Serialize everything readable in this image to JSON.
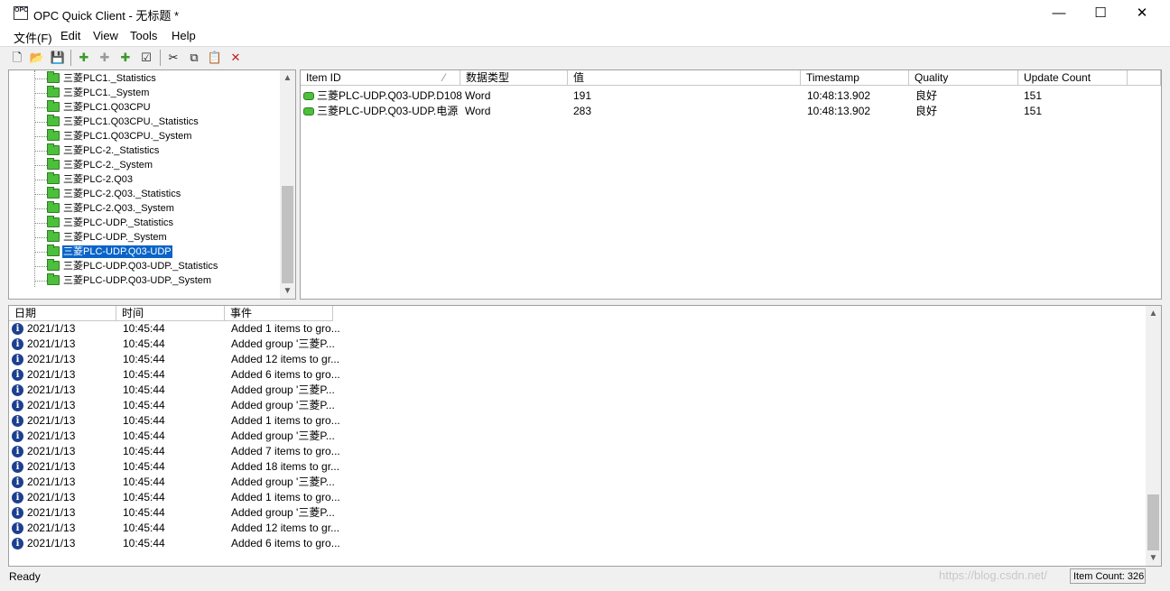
{
  "window": {
    "title": "OPC Quick Client - 无标题 *",
    "app_icon_text": "OPC",
    "controls": {
      "minimize": "—",
      "maximize": "☐",
      "close": "✕"
    }
  },
  "menu": [
    {
      "label": "文件(F)"
    },
    {
      "label": "Edit"
    },
    {
      "label": "View"
    },
    {
      "label": "Tools"
    },
    {
      "label": "Help"
    }
  ],
  "toolbar": {
    "buttons": [
      {
        "name": "new-icon",
        "glyph": "🗋"
      },
      {
        "name": "open-icon",
        "glyph": "📂"
      },
      {
        "name": "save-icon",
        "glyph": "💾"
      },
      {
        "name": "new-server-icon",
        "glyph": "✚"
      },
      {
        "name": "new-group-icon",
        "glyph": "✚"
      },
      {
        "name": "new-item-icon",
        "glyph": "✚"
      },
      {
        "name": "properties-icon",
        "glyph": "☑"
      },
      {
        "name": "cut-icon",
        "glyph": "✂"
      },
      {
        "name": "copy-icon",
        "glyph": "⧉"
      },
      {
        "name": "paste-icon",
        "glyph": "📋"
      },
      {
        "name": "delete-icon",
        "glyph": "✕"
      }
    ]
  },
  "tree": {
    "items": [
      {
        "label": "三菱PLC1._Statistics",
        "selected": false
      },
      {
        "label": "三菱PLC1._System",
        "selected": false
      },
      {
        "label": "三菱PLC1.Q03CPU",
        "selected": false
      },
      {
        "label": "三菱PLC1.Q03CPU._Statistics",
        "selected": false
      },
      {
        "label": "三菱PLC1.Q03CPU._System",
        "selected": false
      },
      {
        "label": "三菱PLC-2._Statistics",
        "selected": false
      },
      {
        "label": "三菱PLC-2._System",
        "selected": false
      },
      {
        "label": "三菱PLC-2.Q03",
        "selected": false
      },
      {
        "label": "三菱PLC-2.Q03._Statistics",
        "selected": false
      },
      {
        "label": "三菱PLC-2.Q03._System",
        "selected": false
      },
      {
        "label": "三菱PLC-UDP._Statistics",
        "selected": false
      },
      {
        "label": "三菱PLC-UDP._System",
        "selected": false
      },
      {
        "label": "三菱PLC-UDP.Q03-UDP",
        "selected": true
      },
      {
        "label": "三菱PLC-UDP.Q03-UDP._Statistics",
        "selected": false
      },
      {
        "label": "三菱PLC-UDP.Q03-UDP._System",
        "selected": false
      }
    ]
  },
  "items_view": {
    "columns": [
      "Item ID",
      "数据类型",
      "值",
      "Timestamp",
      "Quality",
      "Update Count"
    ],
    "sort_indicator": "⁄",
    "rows": [
      {
        "item_id": "三菱PLC-UDP.Q03-UDP.D108",
        "type": "Word",
        "value": "191",
        "timestamp": "10:48:13.902",
        "quality": "良好",
        "update_count": "151"
      },
      {
        "item_id": "三菱PLC-UDP.Q03-UDP.电源",
        "type": "Word",
        "value": "283",
        "timestamp": "10:48:13.902",
        "quality": "良好",
        "update_count": "151"
      }
    ]
  },
  "log": {
    "columns": [
      "日期",
      "时间",
      "事件"
    ],
    "rows": [
      {
        "date": "2021/1/13",
        "time": "10:45:44",
        "event": "Added 1 items to gro..."
      },
      {
        "date": "2021/1/13",
        "time": "10:45:44",
        "event": "Added group '三菱P..."
      },
      {
        "date": "2021/1/13",
        "time": "10:45:44",
        "event": "Added 12 items to gr..."
      },
      {
        "date": "2021/1/13",
        "time": "10:45:44",
        "event": "Added 6 items to gro..."
      },
      {
        "date": "2021/1/13",
        "time": "10:45:44",
        "event": "Added group '三菱P..."
      },
      {
        "date": "2021/1/13",
        "time": "10:45:44",
        "event": "Added group '三菱P..."
      },
      {
        "date": "2021/1/13",
        "time": "10:45:44",
        "event": "Added 1 items to gro..."
      },
      {
        "date": "2021/1/13",
        "time": "10:45:44",
        "event": "Added group '三菱P..."
      },
      {
        "date": "2021/1/13",
        "time": "10:45:44",
        "event": "Added 7 items to gro..."
      },
      {
        "date": "2021/1/13",
        "time": "10:45:44",
        "event": "Added 18 items to gr..."
      },
      {
        "date": "2021/1/13",
        "time": "10:45:44",
        "event": "Added group '三菱P..."
      },
      {
        "date": "2021/1/13",
        "time": "10:45:44",
        "event": "Added 1 items to gro..."
      },
      {
        "date": "2021/1/13",
        "time": "10:45:44",
        "event": "Added group '三菱P..."
      },
      {
        "date": "2021/1/13",
        "time": "10:45:44",
        "event": "Added 12 items to gr..."
      },
      {
        "date": "2021/1/13",
        "time": "10:45:44",
        "event": "Added 6 items to gro..."
      }
    ]
  },
  "status": {
    "text": "Ready",
    "item_count": "Item Count: 326",
    "watermark": "https://blog.csdn.net/"
  },
  "colors": {
    "selection": "#0a64c8",
    "folder": "#4cbf3c",
    "info": "#1d3f8f"
  }
}
